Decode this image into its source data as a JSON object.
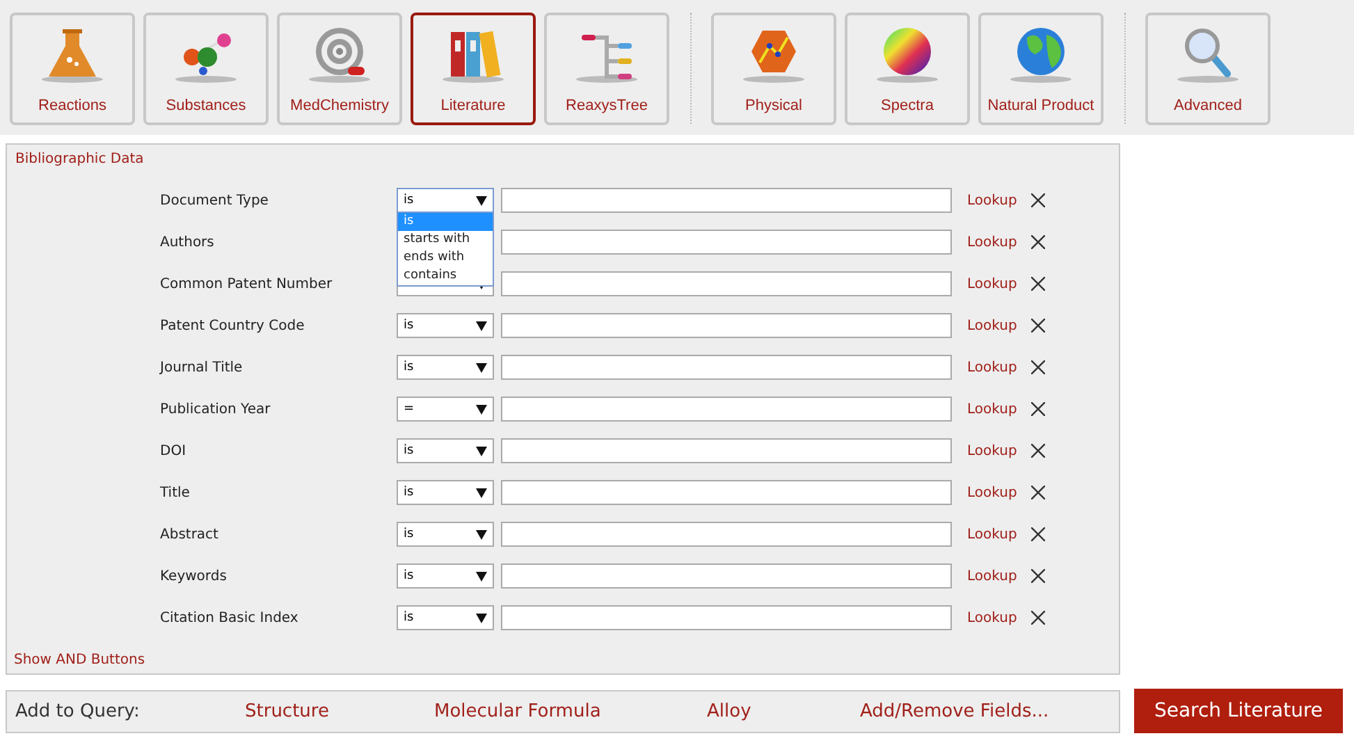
{
  "toolbar_groups": [
    [
      {
        "label": "Reactions",
        "selected": false
      },
      {
        "label": "Substances",
        "selected": false
      },
      {
        "label": "MedChemistry",
        "selected": false
      },
      {
        "label": "Literature",
        "selected": true
      },
      {
        "label": "ReaxysTree",
        "selected": false
      }
    ],
    [
      {
        "label": "Physical",
        "selected": false
      },
      {
        "label": "Spectra",
        "selected": false
      },
      {
        "label": "Natural Product",
        "selected": false
      }
    ],
    [
      {
        "label": "Advanced",
        "selected": false
      }
    ]
  ],
  "panel": {
    "title": "Bibliographic Data",
    "footer_link": "Show AND Buttons",
    "rows": [
      {
        "label": "Document Type",
        "operator": "is",
        "lookup": "Lookup",
        "dropdown_open": true
      },
      {
        "label": "Authors",
        "lookup": "Lookup",
        "select_shown": false
      },
      {
        "label": "Common Patent Number",
        "lookup": "Lookup",
        "dropdown_open": false
      },
      {
        "label": "Patent Country Code",
        "operator": "is",
        "lookup": "Lookup",
        "dropdown_open": false
      },
      {
        "label": "Journal Title",
        "operator": "is",
        "lookup": "Lookup",
        "dropdown_open": false
      },
      {
        "label": "Publication Year",
        "operator": "=",
        "lookup": "Lookup",
        "dropdown_open": false
      },
      {
        "label": "DOI",
        "operator": "is",
        "lookup": "Lookup",
        "dropdown_open": false
      },
      {
        "label": "Title",
        "operator": "is",
        "lookup": "Lookup",
        "dropdown_open": false
      },
      {
        "label": "Abstract",
        "operator": "is",
        "lookup": "Lookup",
        "dropdown_open": false
      },
      {
        "label": "Keywords",
        "operator": "is",
        "lookup": "Lookup",
        "dropdown_open": false
      },
      {
        "label": "Citation Basic Index",
        "operator": "is",
        "lookup": "Lookup",
        "dropdown_open": false
      }
    ],
    "dropdown_options": [
      {
        "label": "is",
        "selected": true
      },
      {
        "label": "starts with",
        "selected": false
      },
      {
        "label": "ends with",
        "selected": false
      },
      {
        "label": "contains",
        "selected": false
      }
    ]
  },
  "query_bar": {
    "label": "Add to Query:",
    "links": [
      "Structure",
      "Molecular Formula",
      "Alloy",
      "Add/Remove Fields..."
    ]
  },
  "search_button": "Search Literature"
}
